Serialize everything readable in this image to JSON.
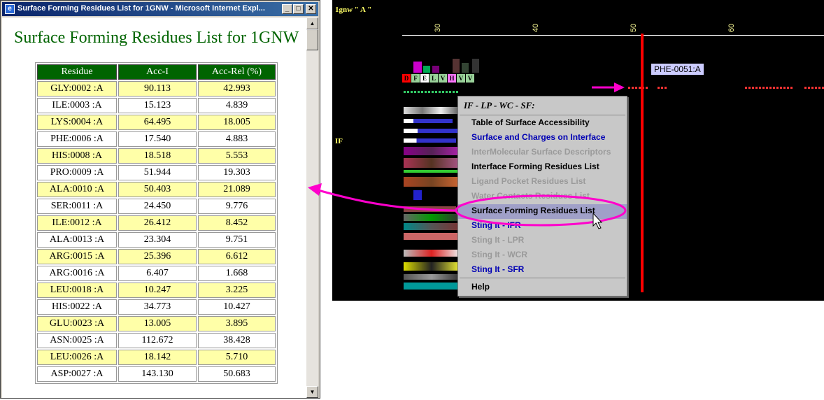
{
  "window": {
    "title": "Surface Forming Residues List for 1GNW - Microsoft Internet Expl...",
    "minimize": "_",
    "maximize": "□",
    "close": "✕"
  },
  "page": {
    "heading": "Surface Forming Residues List for 1GNW"
  },
  "table": {
    "headers": [
      "Residue",
      "Acc-I",
      "Acc-Rel (%)"
    ],
    "rows": [
      [
        "GLY:0002 :A",
        "90.113",
        "42.993"
      ],
      [
        "ILE:0003 :A",
        "15.123",
        "4.839"
      ],
      [
        "LYS:0004 :A",
        "64.495",
        "18.005"
      ],
      [
        "PHE:0006 :A",
        "17.540",
        "4.883"
      ],
      [
        "HIS:0008 :A",
        "18.518",
        "5.553"
      ],
      [
        "PRO:0009 :A",
        "51.944",
        "19.303"
      ],
      [
        "ALA:0010 :A",
        "50.403",
        "21.089"
      ],
      [
        "SER:0011 :A",
        "24.450",
        "9.776"
      ],
      [
        "ILE:0012 :A",
        "26.412",
        "8.452"
      ],
      [
        "ALA:0013 :A",
        "23.304",
        "9.751"
      ],
      [
        "ARG:0015 :A",
        "25.396",
        "6.612"
      ],
      [
        "ARG:0016 :A",
        "6.407",
        "1.668"
      ],
      [
        "LEU:0018 :A",
        "10.247",
        "3.225"
      ],
      [
        "HIS:0022 :A",
        "34.773",
        "10.427"
      ],
      [
        "GLU:0023 :A",
        "13.005",
        "3.895"
      ],
      [
        "ASN:0025 :A",
        "112.672",
        "38.428"
      ],
      [
        "LEU:0026 :A",
        "18.142",
        "5.710"
      ],
      [
        "ASP:0027 :A",
        "143.130",
        "50.683"
      ]
    ]
  },
  "viewer": {
    "chain_label": "1gnw \" A \"",
    "if_label": "IF",
    "ticks": [
      "30",
      "40",
      "50",
      "60"
    ],
    "tooltip": "PHE-0051:A",
    "residue_letters": [
      "D",
      "F",
      "E",
      "L",
      "V",
      "H",
      "V",
      "V"
    ],
    "residue_letter_colors": [
      "#ff0000",
      "#9ad39a",
      "#ffffff",
      "#9ad39a",
      "#9ad39a",
      "#ff77ff",
      "#9ad39a",
      "#9ad39a"
    ]
  },
  "menu": {
    "header": "IF - LP - WC - SF:",
    "items": [
      {
        "label": "Table of Surface Accessibility",
        "state": "black"
      },
      {
        "label": "Surface and Charges on Interface",
        "state": "blue"
      },
      {
        "label": "InterMolecular Surface Descriptors",
        "state": "gray"
      },
      {
        "label": "Interface Forming Residues List",
        "state": "black"
      },
      {
        "label": "Ligand Pocket Residues List",
        "state": "gray"
      },
      {
        "label": "Water Contacts Residues List",
        "state": "gray"
      },
      {
        "label": "Surface Forming Residues List",
        "state": "black"
      },
      {
        "label": "Sting It - IFR",
        "state": "blue"
      },
      {
        "label": "Sting It - LPR",
        "state": "gray"
      },
      {
        "label": "Sting It - WCR",
        "state": "gray"
      },
      {
        "label": "Sting It - SFR",
        "state": "blue"
      }
    ],
    "help": "Help"
  },
  "colors": {
    "annotation": "#ff00cc",
    "table_header": "#006400",
    "row_highlight": "#ffffa8"
  }
}
